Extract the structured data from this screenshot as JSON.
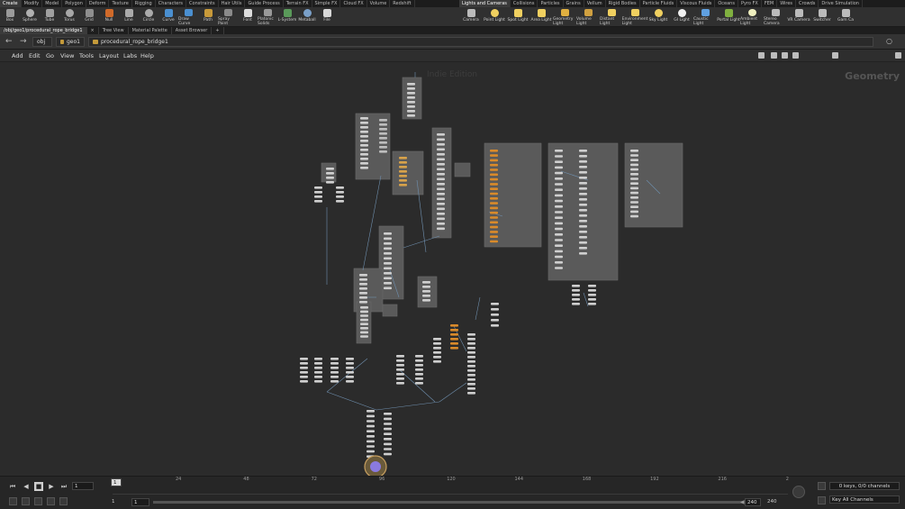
{
  "shelf_tabs_left": [
    "Create",
    "Modify",
    "Model",
    "Polygon",
    "Deform",
    "Texture",
    "Rigging",
    "Characters",
    "Constraints",
    "Hair Utils",
    "Guide Process",
    "Terrain FX",
    "Simple FX",
    "Cloud FX",
    "Volume",
    "Redshift"
  ],
  "shelf_tabs_right": [
    "Lights and Cameras",
    "Collisions",
    "Particles",
    "Grains",
    "Vellum",
    "Rigid Bodies",
    "Particle Fluids",
    "Viscous Fluids",
    "Oceans",
    "Pyro FX",
    "FEM",
    "Wires",
    "Crowds",
    "Drive Simulation"
  ],
  "shelf_tools_left": [
    {
      "label": "Box",
      "icon": "box-icon",
      "color": "#9a9a9a"
    },
    {
      "label": "Sphere",
      "icon": "sphere-icon",
      "color": "#b0b0b0"
    },
    {
      "label": "Tube",
      "icon": "tube-icon",
      "color": "#a0a0a0"
    },
    {
      "label": "Torus",
      "icon": "torus-icon",
      "color": "#a8a8a8"
    },
    {
      "label": "Grid",
      "icon": "grid-icon",
      "color": "#8f8f8f"
    },
    {
      "label": "Null",
      "icon": "null-icon",
      "color": "#d06a2a"
    },
    {
      "label": "Line",
      "icon": "line-icon",
      "color": "#aaaaaa"
    },
    {
      "label": "Circle",
      "icon": "circle-icon",
      "color": "#aaaaaa"
    },
    {
      "label": "Curve",
      "icon": "curve-icon",
      "color": "#4a8fd0"
    },
    {
      "label": "Draw Curve",
      "icon": "draw-curve-icon",
      "color": "#4a8fd0"
    },
    {
      "label": "Path",
      "icon": "path-icon",
      "color": "#c89a3a"
    },
    {
      "label": "Spray Paint",
      "icon": "spray-paint-icon",
      "color": "#8a8a8a"
    },
    {
      "label": "Font",
      "icon": "font-icon",
      "color": "#dddddd"
    },
    {
      "label": "Platonic Solids",
      "icon": "platonic-solids-icon",
      "color": "#999999"
    },
    {
      "label": "L-System",
      "icon": "l-system-icon",
      "color": "#5a9a5a"
    },
    {
      "label": "Metaball",
      "icon": "metaball-icon",
      "color": "#7aa0c8"
    },
    {
      "label": "File",
      "icon": "file-icon",
      "color": "#d8d8d8"
    }
  ],
  "shelf_tools_right": [
    {
      "label": "Camera",
      "icon": "camera-icon",
      "color": "#bbbbbb"
    },
    {
      "label": "Point Light",
      "icon": "point-light-icon",
      "color": "#f0d060"
    },
    {
      "label": "Spot Light",
      "icon": "spot-light-icon",
      "color": "#f0d060"
    },
    {
      "label": "Area Light",
      "icon": "area-light-icon",
      "color": "#f0d060"
    },
    {
      "label": "Geometry Light",
      "icon": "geometry-light-icon",
      "color": "#e0b040"
    },
    {
      "label": "Volume Light",
      "icon": "volume-light-icon",
      "color": "#d0a040"
    },
    {
      "label": "Distant Light",
      "icon": "distant-light-icon",
      "color": "#f0d060"
    },
    {
      "label": "Environment Light",
      "icon": "environment-light-icon",
      "color": "#f0d060"
    },
    {
      "label": "Sky Light",
      "icon": "sky-light-icon",
      "color": "#f0d060"
    },
    {
      "label": "GI Light",
      "icon": "gi-light-icon",
      "color": "#f0f0f0"
    },
    {
      "label": "Caustic Light",
      "icon": "caustic-light-icon",
      "color": "#60a0e0"
    },
    {
      "label": "Portal Light",
      "icon": "portal-light-icon",
      "color": "#80b040"
    },
    {
      "label": "Ambient Light",
      "icon": "ambient-light-icon",
      "color": "#f0f0c0"
    },
    {
      "label": "Stereo Camera",
      "icon": "stereo-camera-icon",
      "color": "#bbbbbb"
    },
    {
      "label": "VR Camera",
      "icon": "vr-camera-icon",
      "color": "#bbbbbb"
    },
    {
      "label": "Switcher",
      "icon": "switcher-icon",
      "color": "#bbbbbb"
    },
    {
      "label": "Gam Ca",
      "icon": "gamepad-camera-icon",
      "color": "#bbbbbb"
    }
  ],
  "path_tabs": [
    "/obj/geo1/procedural_rope_bridge1",
    "Tree View",
    "Material Palette",
    "Asset Browser"
  ],
  "crumbs": {
    "root": "obj",
    "geo": "geo1",
    "node": "procedural_rope_bridge1"
  },
  "menus": [
    "Add",
    "Edit",
    "Go",
    "View",
    "Tools",
    "Layout",
    "Labs",
    "Help"
  ],
  "network": {
    "edition": "Indie Edition",
    "context": "Geometry"
  },
  "timeline": {
    "current_frame": "1",
    "start_frame": "1",
    "start_frame2": "1",
    "end_frame": "240",
    "end_frame2": "240",
    "tick_labels": [
      "24",
      "48",
      "72",
      "96",
      "120",
      "144",
      "168",
      "192",
      "216",
      "2"
    ],
    "keys_info": "0 keys, 0/0 channels",
    "channels_menu": "Key All Channels"
  }
}
